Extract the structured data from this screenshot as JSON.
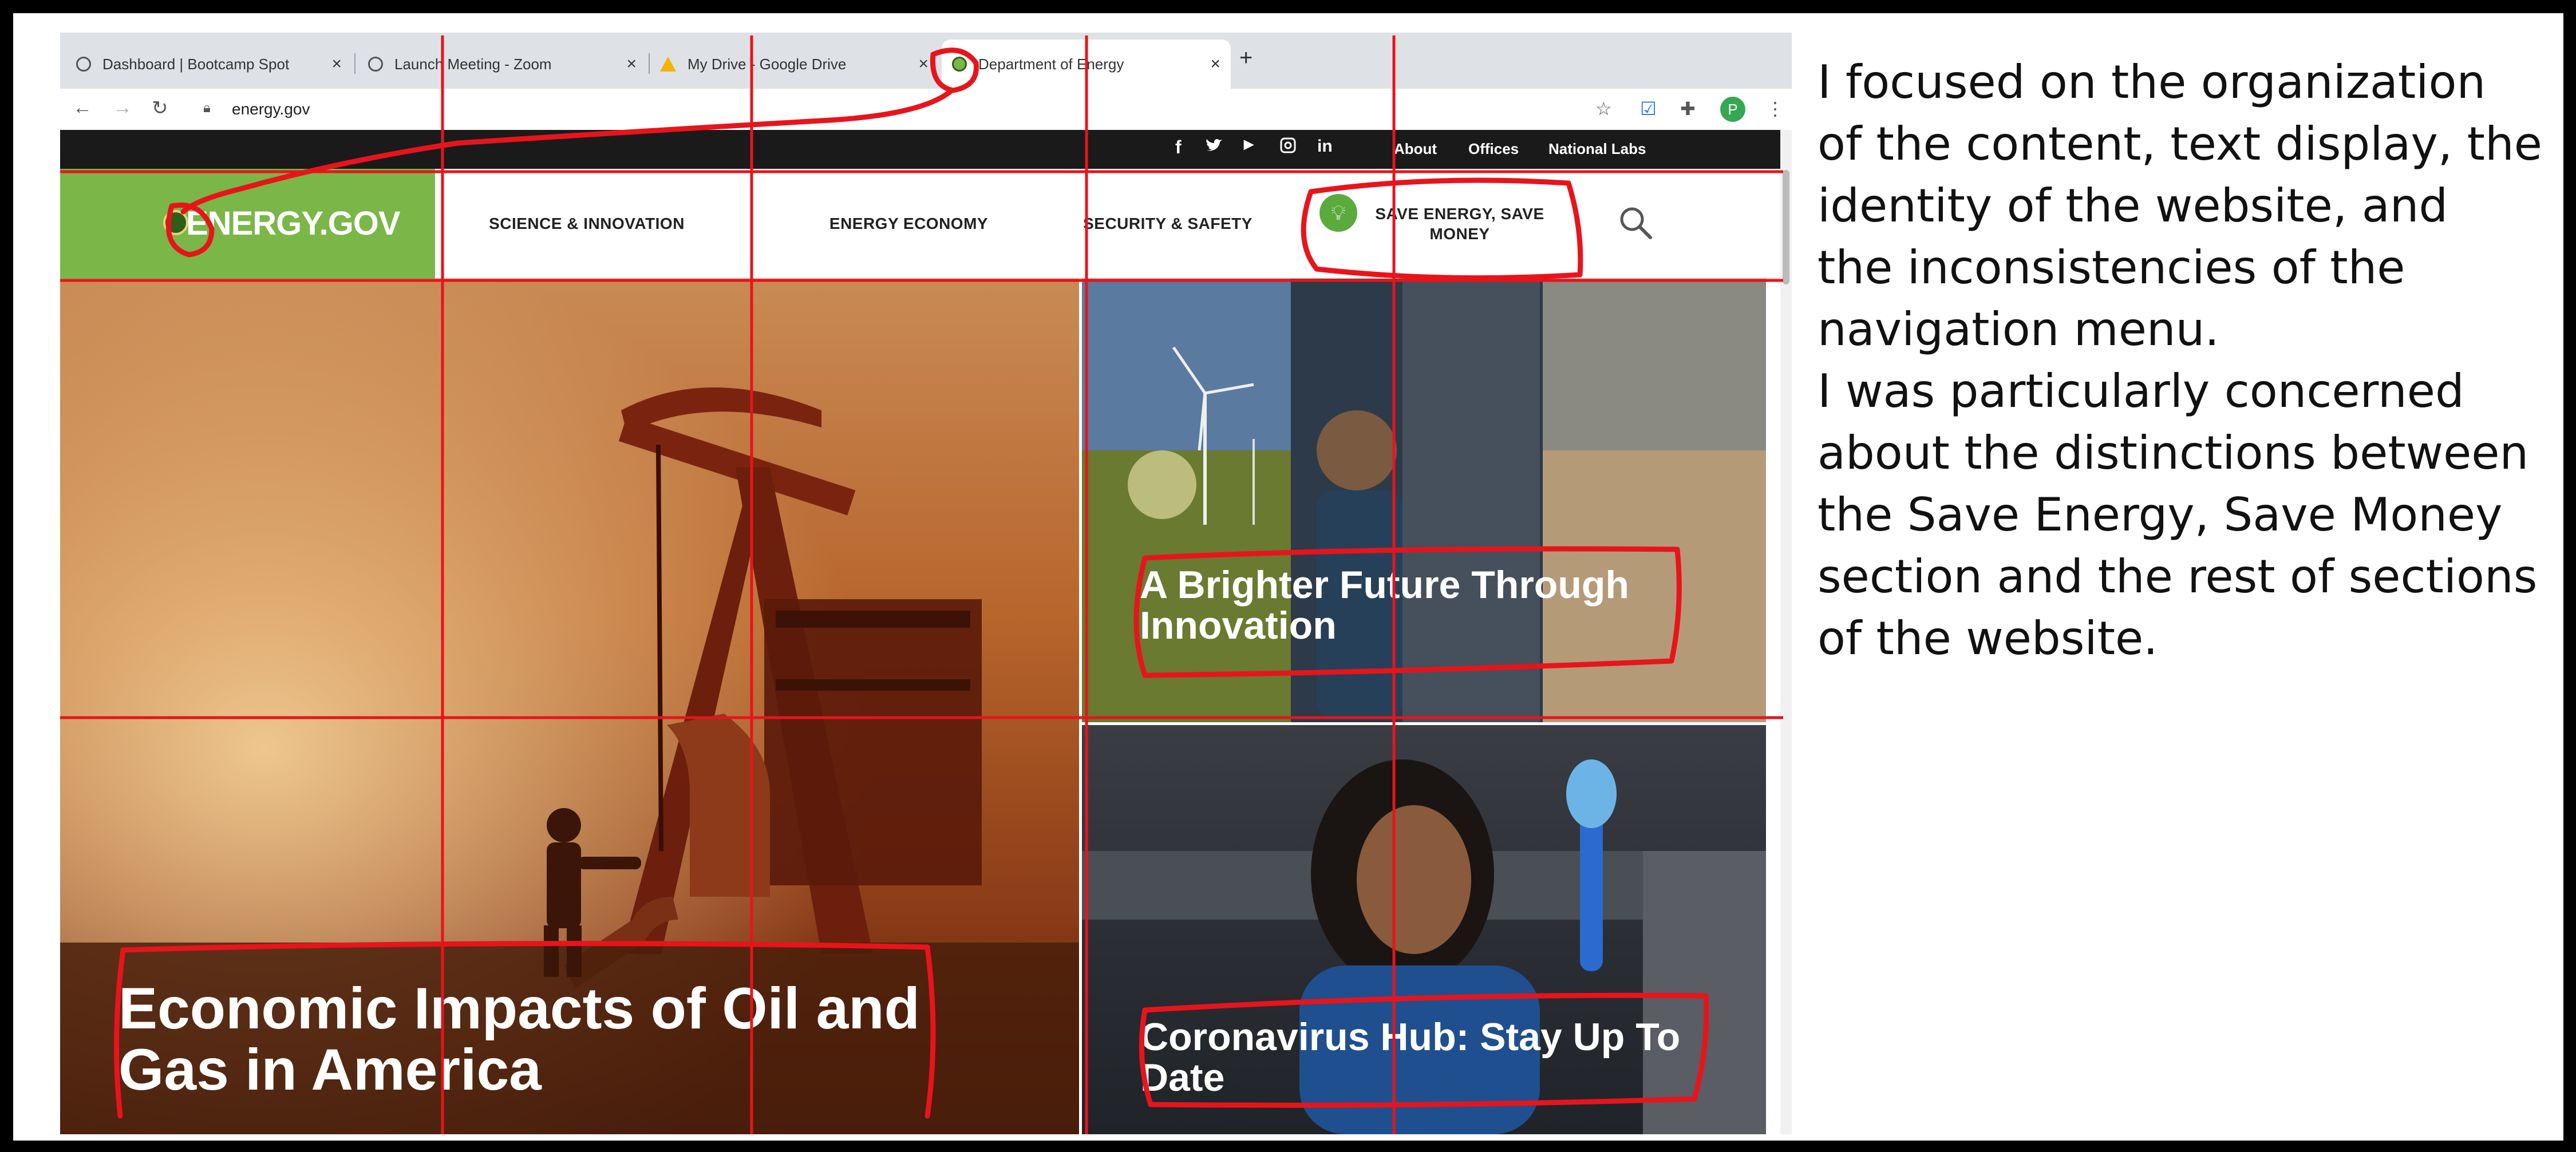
{
  "browser": {
    "tabs": [
      {
        "label": "Dashboard | Bootcamp Spot",
        "close": "×",
        "active": false
      },
      {
        "label": "Launch Meeting - Zoom",
        "close": "×",
        "active": false
      },
      {
        "label": "My Drive - Google Drive",
        "close": "×",
        "active": false
      },
      {
        "label": "Department of Energy",
        "close": "×",
        "active": true
      }
    ],
    "new_tab": "+",
    "nav": {
      "back": "←",
      "forward": "→",
      "reload": "↻"
    },
    "url": "energy.gov",
    "profile_initial": "P",
    "toolbar_icons": [
      "star-icon",
      "extension-check-icon",
      "puzzle-icon",
      "profile-avatar",
      "more-icon"
    ]
  },
  "site": {
    "utility": {
      "social": [
        "f",
        "t",
        "yt",
        "ig",
        "in"
      ],
      "links": [
        "About",
        "Offices",
        "National Labs"
      ]
    },
    "logo": "ENERGY.GOV",
    "nav": [
      {
        "label": "SCIENCE & INNOVATION"
      },
      {
        "label": "ENERGY ECONOMY"
      },
      {
        "label": "SECURITY & SAFETY"
      },
      {
        "label": "SAVE ENERGY, SAVE MONEY"
      }
    ],
    "hero": [
      {
        "title": "Economic Impacts of Oil and Gas in America"
      },
      {
        "title": "A Brighter Future Through Innovation"
      },
      {
        "title": "Coronavirus Hub: Stay Up To Date"
      }
    ]
  },
  "commentary": [
    "I focused on the organization",
    "of the content, text display, the",
    "identity of the website, and",
    "the inconsistencies of the",
    "navigation menu.",
    "I was particularly concerned",
    "about the distinctions between",
    "the Save Energy, Save Money",
    "section and the rest of sections",
    "of the website."
  ],
  "colors": {
    "annotation_red": "#e8141b",
    "energy_green": "#7ab648",
    "utility_bar": "#1a1a1a"
  }
}
